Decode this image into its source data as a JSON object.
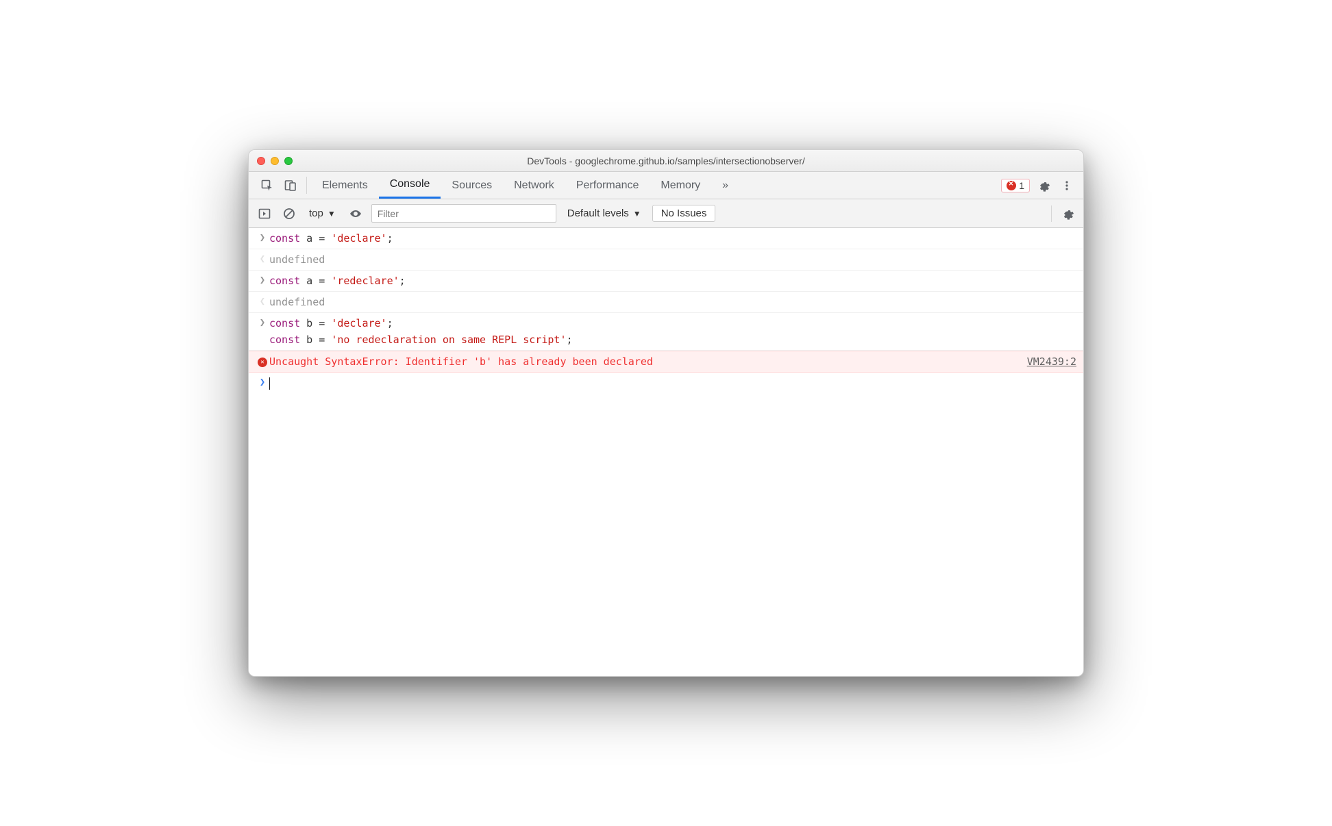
{
  "window": {
    "title": "DevTools - googlechrome.github.io/samples/intersectionobserver/"
  },
  "tabs": {
    "items": [
      "Elements",
      "Console",
      "Sources",
      "Network",
      "Performance",
      "Memory"
    ],
    "active_index": 1,
    "more_glyph": "»",
    "error_count": "1"
  },
  "toolbar": {
    "context_label": "top",
    "filter_placeholder": "Filter",
    "levels_label": "Default levels",
    "issues_label": "No Issues"
  },
  "console": {
    "entries": [
      {
        "type": "input",
        "lines": [
          [
            {
              "t": "const",
              "c": "kw"
            },
            {
              "t": " a ",
              "c": "eq"
            },
            {
              "t": "=",
              "c": "eq"
            },
            {
              "t": " ",
              "c": "eq"
            },
            {
              "t": "'declare'",
              "c": "str"
            },
            {
              "t": ";",
              "c": "eq"
            }
          ]
        ]
      },
      {
        "type": "response",
        "text": "undefined"
      },
      {
        "type": "input",
        "lines": [
          [
            {
              "t": "const",
              "c": "kw"
            },
            {
              "t": " a ",
              "c": "eq"
            },
            {
              "t": "=",
              "c": "eq"
            },
            {
              "t": " ",
              "c": "eq"
            },
            {
              "t": "'redeclare'",
              "c": "str"
            },
            {
              "t": ";",
              "c": "eq"
            }
          ]
        ]
      },
      {
        "type": "response",
        "text": "undefined"
      },
      {
        "type": "input",
        "lines": [
          [
            {
              "t": "const",
              "c": "kw"
            },
            {
              "t": " b ",
              "c": "eq"
            },
            {
              "t": "=",
              "c": "eq"
            },
            {
              "t": " ",
              "c": "eq"
            },
            {
              "t": "'declare'",
              "c": "str"
            },
            {
              "t": ";",
              "c": "eq"
            }
          ],
          [
            {
              "t": "const",
              "c": "kw"
            },
            {
              "t": " b ",
              "c": "eq"
            },
            {
              "t": "=",
              "c": "eq"
            },
            {
              "t": " ",
              "c": "eq"
            },
            {
              "t": "'no redeclaration on same REPL script'",
              "c": "str"
            },
            {
              "t": ";",
              "c": "eq"
            }
          ]
        ]
      },
      {
        "type": "error",
        "text": "Uncaught SyntaxError: Identifier 'b' has already been declared",
        "link": "VM2439:2"
      },
      {
        "type": "prompt"
      }
    ]
  }
}
